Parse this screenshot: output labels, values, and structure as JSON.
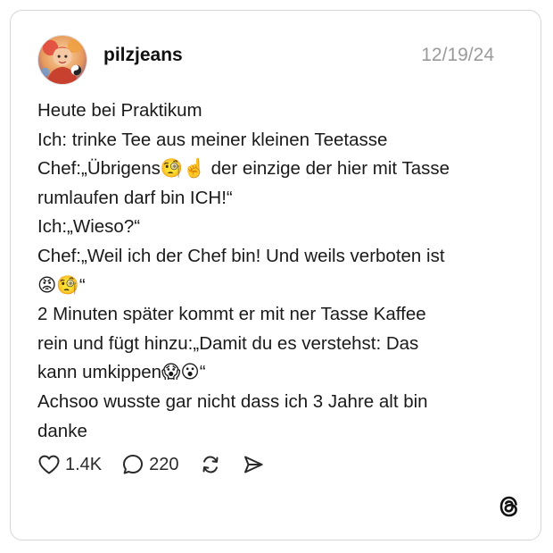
{
  "post": {
    "username": "pilzjeans",
    "date": "12/19/24",
    "lines": [
      "Heute bei Praktikum",
      "Ich: trinke Tee aus meiner kleinen Teetasse",
      "Chef:„Übrigens🧐☝️ der einzige der hier mit Tasse",
      "rumlaufen darf bin ICH!“",
      "Ich:„Wieso?“",
      "Chef:„Weil ich der Chef bin! Und weils verboten ist",
      "😡🧐“",
      "2 Minuten später kommt er mit ner Tasse Kaffee",
      "rein und fügt hinzu:„Damit du es verstehst: Das",
      "kann umkippen😱😮“",
      "Achsoo wusste gar nicht dass ich 3 Jahre alt bin",
      "danke"
    ],
    "stats": {
      "likes": "1.4K",
      "replies": "220"
    }
  },
  "icons": {
    "like": "heart-icon",
    "reply": "comment-bubble-icon",
    "repost": "repost-icon",
    "share": "send-icon",
    "logo": "threads-logo-icon",
    "avatar": "avatar-image"
  },
  "colors": {
    "text": "#1a1a1a",
    "muted": "#9a9a9a",
    "border": "#d6d6d6"
  }
}
